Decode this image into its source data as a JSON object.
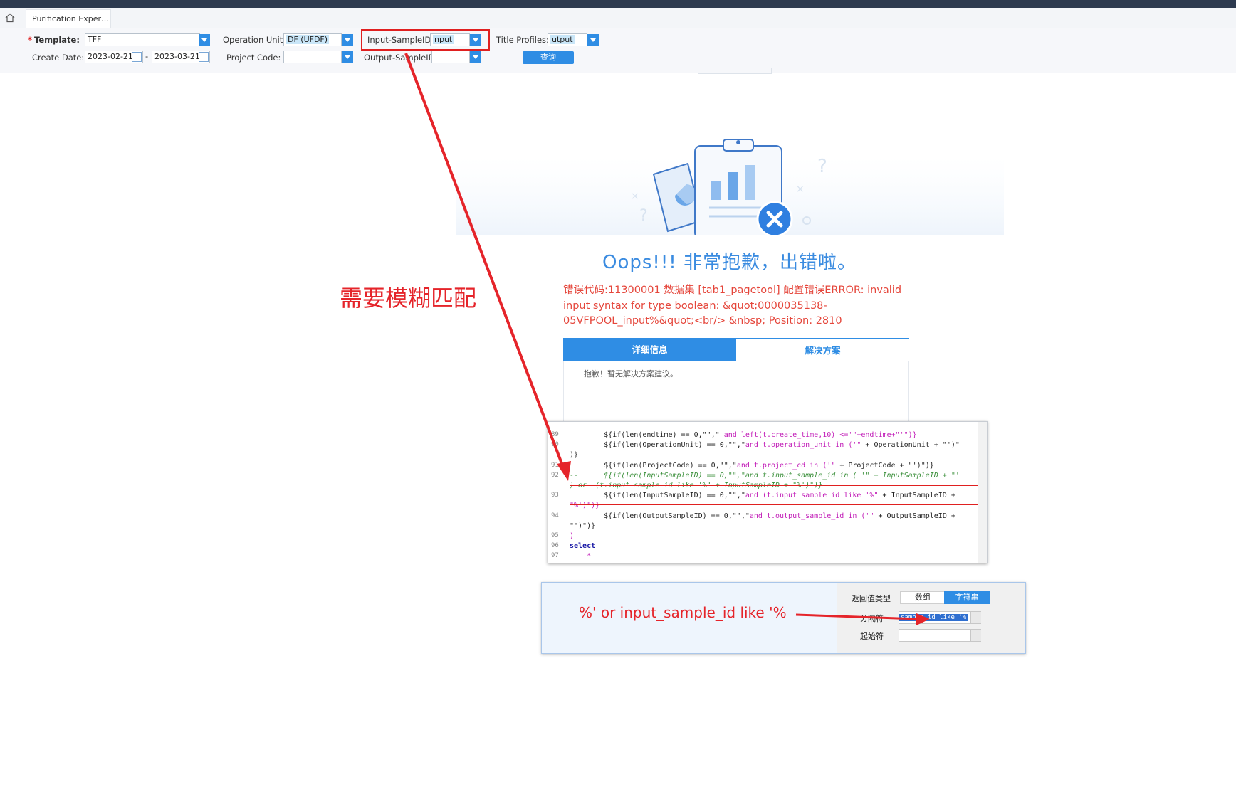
{
  "tabs": {
    "home_icon": "home-icon",
    "active_tab": "Purification Experi..."
  },
  "filters": {
    "template_label": "Template:",
    "template_value": "TFF",
    "create_date_label": "Create Date:",
    "create_date_from": "2023-02-21",
    "create_date_sep": "-",
    "create_date_to": "2023-03-21",
    "operation_unit_label": "Operation Unit:",
    "operation_unit_value": "DF (UFDF)",
    "project_code_label": "Project Code:",
    "project_code_value": "",
    "input_sample_label": "Input-SampleID:",
    "input_sample_value": "nput",
    "output_sample_label": "Output-SampleID:",
    "output_sample_value": "",
    "title_profiles_label": "Title Profiles:",
    "title_profiles_value": "utput",
    "query_button": "查询"
  },
  "error": {
    "title": "Oops!!! 非常抱歉，出错啦。",
    "message": "错误代码:11300001 数据集 [tab1_pagetool] 配置错误ERROR: invalid input syntax for type boolean: &quot;0000035138-05VFPOOL_input%&quot;<br/> &nbsp; Position: 2810",
    "tab_detail": "详细信息",
    "tab_solution": "解决方案",
    "no_solution": "抱歉！暂无解决方案建议。"
  },
  "annotations": {
    "fuzzy_match": "需要模糊匹配",
    "separator_value_note": "%' or input_sample_id like '%"
  },
  "code_lines": [
    {
      "num": "89",
      "parts": [
        {
          "t": "        ${if(len(endtime) == 0,\"\",\"",
          "c": "dk"
        },
        {
          "t": " and left(t.create_time,10) <='\"+endtime+\"'\")}",
          "c": "kw-m"
        }
      ]
    },
    {
      "num": "90",
      "parts": [
        {
          "t": "        ${if(len(OperationUnit) == 0,\"\",\"",
          "c": "dk"
        },
        {
          "t": "and t.operation_unit in ('\"",
          "c": "kw-m"
        },
        {
          "t": " + OperationUnit + \"')\"",
          "c": "dk"
        }
      ]
    },
    {
      "num": "",
      "parts": [
        {
          "t": ")}",
          "c": "dk"
        }
      ]
    },
    {
      "num": "91",
      "parts": [
        {
          "t": "        ${if(len(ProjectCode) == 0,\"\",\"",
          "c": "dk"
        },
        {
          "t": "and t.project_cd in ('\"",
          "c": "kw-m"
        },
        {
          "t": " + ProjectCode + \"')\")}",
          "c": "dk"
        }
      ]
    },
    {
      "num": "92",
      "parts": [
        {
          "t": "--      ${if(len(InputSampleID) == 0,\"\",\"and t.input_sample_id in ( '\" + InputSampleID + \"'",
          "c": "cm"
        }
      ]
    },
    {
      "num": "",
      "parts": [
        {
          "t": ") or  (t.input_sample_id like '%\" + InputSampleID + \"%')\")}",
          "c": "cm"
        }
      ]
    },
    {
      "num": "93",
      "parts": [
        {
          "t": "        ${if(len(InputSampleID) == 0,\"\",\"",
          "c": "dk"
        },
        {
          "t": "and (t.input_sample_id like '%\"",
          "c": "kw-m"
        },
        {
          "t": " + InputSampleID +",
          "c": "dk"
        }
      ]
    },
    {
      "num": "",
      "parts": [
        {
          "t": "\"%')\")}",
          "c": "kw-m"
        }
      ]
    },
    {
      "num": "94",
      "parts": [
        {
          "t": "        ${if(len(OutputSampleID) == 0,\"\",\"",
          "c": "dk"
        },
        {
          "t": "and t.output_sample_id in ('\"",
          "c": "kw-m"
        },
        {
          "t": " + OutputSampleID +",
          "c": "dk"
        }
      ]
    },
    {
      "num": "",
      "parts": [
        {
          "t": "\"')\")}",
          "c": "dk"
        }
      ]
    },
    {
      "num": "95",
      "parts": [
        {
          "t": ")",
          "c": "kw-m"
        }
      ]
    },
    {
      "num": "96",
      "parts": [
        {
          "t": "select",
          "c": "kw-b"
        }
      ]
    },
    {
      "num": "97",
      "parts": [
        {
          "t": "    *",
          "c": "kw-m"
        }
      ]
    }
  ],
  "settings": {
    "return_type_label": "返回值类型",
    "seg_number": "数组",
    "seg_string": "字符串",
    "separator_label": "分隔符",
    "separator_value": "sample_id like '%",
    "start_char_label": "起始符",
    "start_char_value": ""
  },
  "colors": {
    "accent": "#2f8de4",
    "error": "#e5463b",
    "annotation": "#e5242a"
  }
}
